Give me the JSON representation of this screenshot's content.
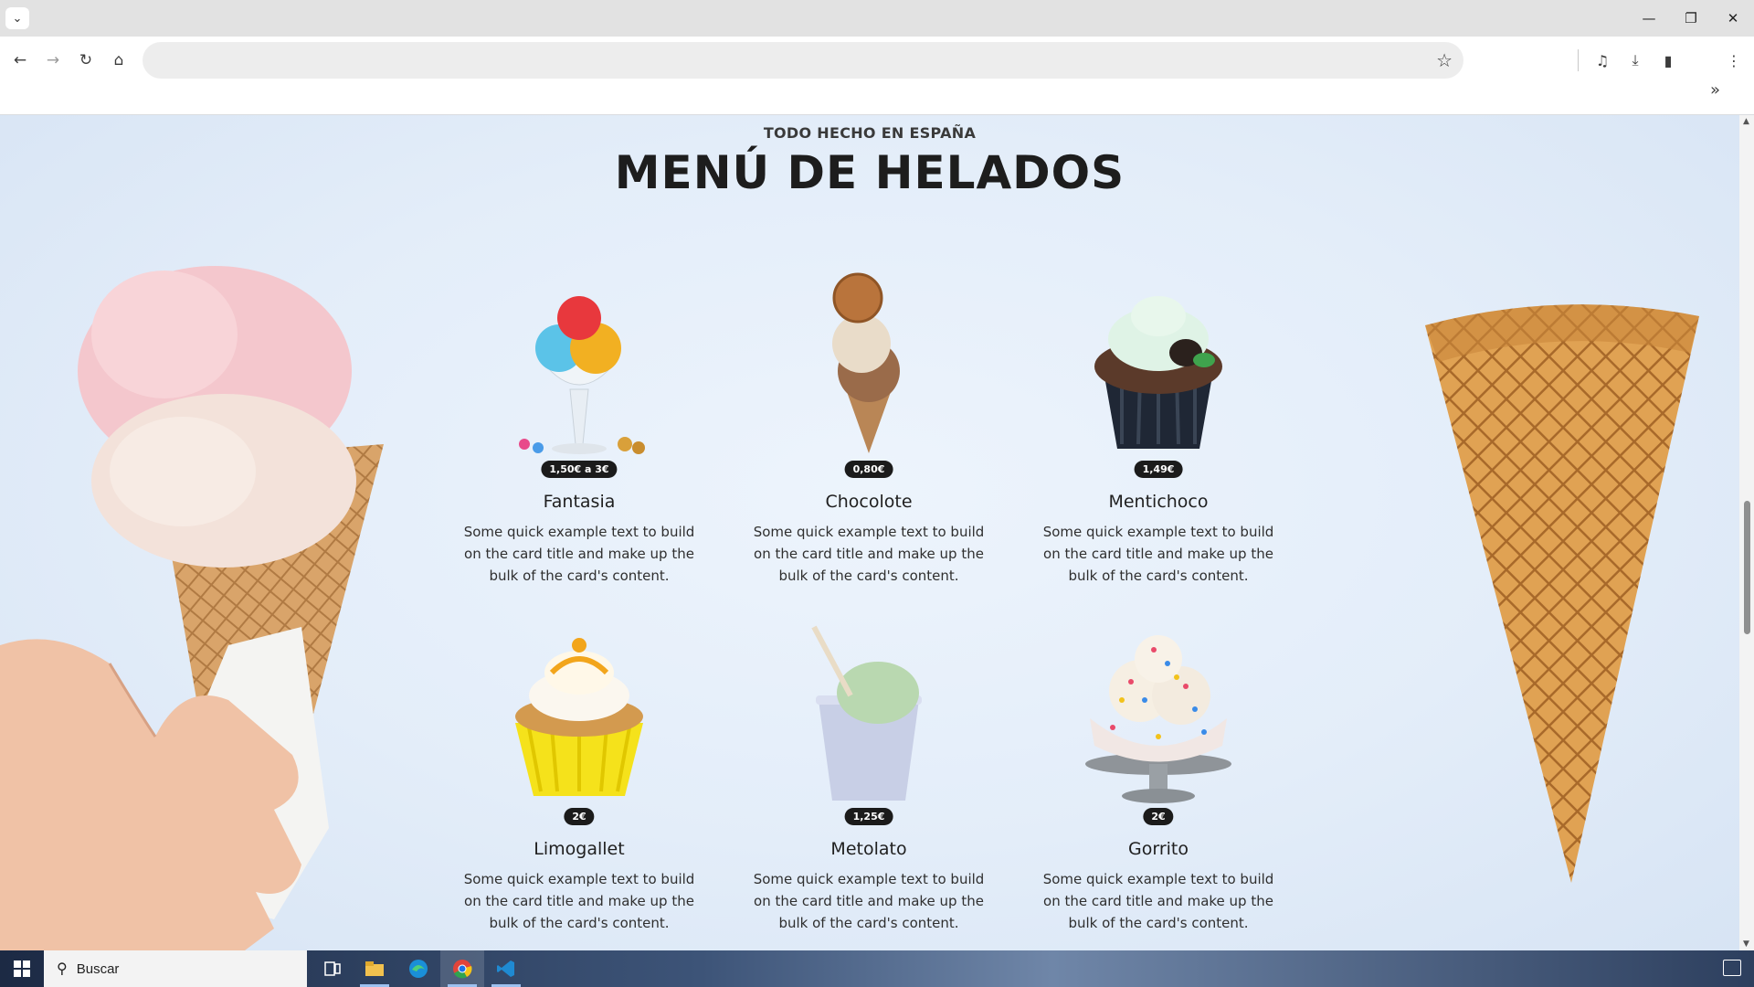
{
  "browser": {
    "tab_dropdown_icon": "chevron-down-icon",
    "window_controls": [
      "minimize-icon",
      "restore-icon",
      "close-icon"
    ],
    "address_value": "",
    "nav_icons": [
      "back-icon",
      "forward-icon",
      "reload-icon",
      "home-icon"
    ],
    "right_icons": [
      "bookmark-star-icon",
      "media-controls-icon",
      "download-icon",
      "side-panel-icon",
      "more-menu-icon"
    ],
    "bookmarks_more_icon": "chevron-double-right-icon"
  },
  "section": {
    "eyebrow": "TODO HECHO EN ESPAÑA",
    "title": "MENÚ DE HELADOS"
  },
  "cards": [
    {
      "title": "Fantasia",
      "price": "1,50€ a 3€",
      "text": "Some quick example text to build on the card title and make up the bulk of the card's content."
    },
    {
      "title": "Chocolote",
      "price": "0,80€",
      "text": "Some quick example text to build on the card title and make up the bulk of the card's content."
    },
    {
      "title": "Mentichoco",
      "price": "1,49€",
      "text": "Some quick example text to build on the card title and make up the bulk of the card's content."
    },
    {
      "title": "Limogallet",
      "price": "2€",
      "text": "Some quick example text to build on the card title and make up the bulk of the card's content."
    },
    {
      "title": "Metolato",
      "price": "1,25€",
      "text": "Some quick example text to build on the card title and make up the bulk of the card's content."
    },
    {
      "title": "Gorrito",
      "price": "2€",
      "text": "Some quick example text to build on the card title and make up the bulk of the card's content."
    }
  ],
  "taskbar": {
    "search_placeholder": "Buscar",
    "apps": [
      "task-view-icon",
      "file-explorer-icon",
      "edge-icon",
      "chrome-icon",
      "vscode-icon"
    ]
  },
  "colors": {
    "background": "#dfe9f7",
    "price_badge": "#1b1b1b",
    "title": "#1d1d1d"
  }
}
